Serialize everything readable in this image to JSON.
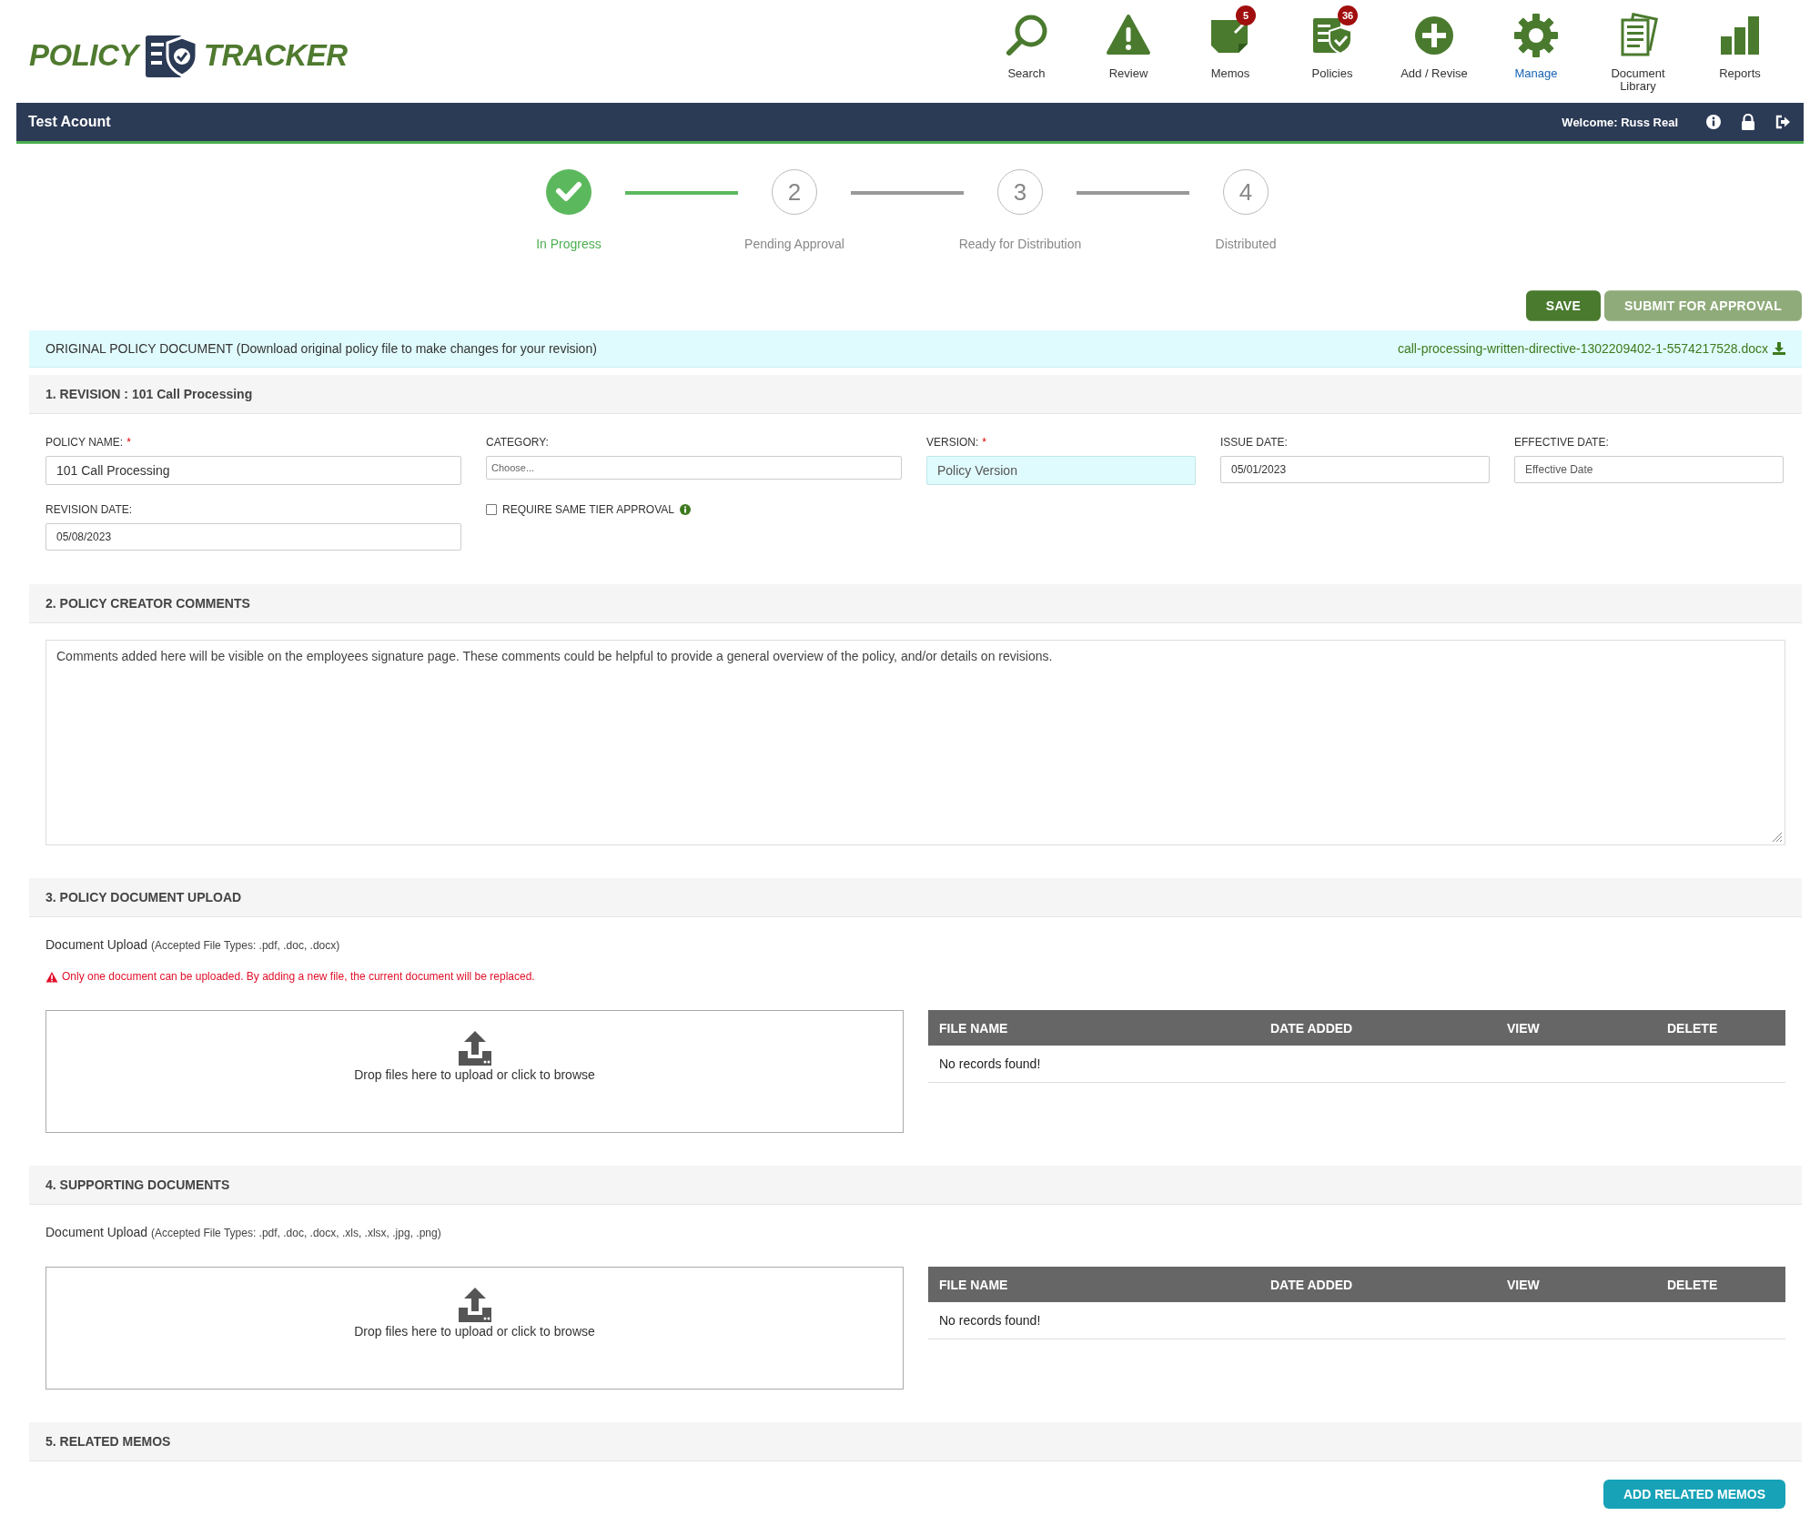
{
  "logo": {
    "left": "POLICY",
    "right": "TRACKER"
  },
  "nav": [
    {
      "label": "Search",
      "kind": "search",
      "selected": false
    },
    {
      "label": "Review",
      "kind": "review",
      "selected": false
    },
    {
      "label": "Memos",
      "kind": "memos",
      "badge": "5",
      "selected": false
    },
    {
      "label": "Policies",
      "kind": "policies",
      "badge": "36",
      "selected": false
    },
    {
      "label": "Add / Revise",
      "kind": "add",
      "selected": false
    },
    {
      "label": "Manage",
      "kind": "manage",
      "selected": true
    },
    {
      "label": "Document Library",
      "kind": "library",
      "selected": false
    },
    {
      "label": "Reports",
      "kind": "reports",
      "selected": false
    }
  ],
  "account_bar": {
    "account": "Test Acount",
    "welcome": "Welcome: Russ Real"
  },
  "steps": [
    {
      "label": "In Progress",
      "done": true
    },
    {
      "number": "2",
      "label": "Pending Approval",
      "done": false
    },
    {
      "number": "3",
      "label": "Ready for Distribution",
      "done": false
    },
    {
      "number": "4",
      "label": "Distributed",
      "done": false
    }
  ],
  "actions": [
    {
      "label": "SAVE",
      "kind": "primary"
    },
    {
      "label": "SUBMIT FOR APPROVAL",
      "kind": "secondary"
    }
  ],
  "original_document": {
    "text": "ORIGINAL POLICY DOCUMENT (Download original policy file to make changes for your revision)",
    "file": "call-processing-written-directive-1302209402-1-5574217528.docx"
  },
  "sections": [
    {
      "kind": "revision",
      "title": "1. REVISION : 101 Call Processing",
      "fields": [
        {
          "kind": "text",
          "label": "POLICY NAME:",
          "required_mark": "*",
          "value": "101 Call Processing",
          "highlighted": false
        },
        {
          "kind": "select",
          "label": "CATEGORY:",
          "placeholder": "Choose...",
          "highlighted": false
        },
        {
          "kind": "text",
          "label": "VERSION:",
          "required_mark": "*",
          "placeholder": "Policy Version",
          "highlighted": true
        },
        {
          "kind": "date",
          "label": "ISSUE DATE:",
          "value": "05/01/2023",
          "highlighted": false
        },
        {
          "kind": "date",
          "label": "EFFECTIVE DATE:",
          "placeholder": "Effective Date",
          "highlighted": false
        },
        {
          "kind": "date",
          "label": "REVISION DATE:",
          "value": "05/08/2023",
          "highlighted": false
        },
        {
          "kind": "checkbox",
          "label": "REQUIRE SAME TIER APPROVAL",
          "checked": false
        }
      ]
    },
    {
      "kind": "comments",
      "title": "2. POLICY CREATOR COMMENTS",
      "value": "Comments added here will be visible on the employees signature page. These comments could be helpful to provide a general overview of the policy, and/or details on revisions."
    },
    {
      "kind": "upload",
      "title": "3. POLICY DOCUMENT UPLOAD",
      "caption": "Document Upload",
      "hint": "(Accepted File Types: .pdf, .doc, .docx)",
      "warning": "Only one document can be uploaded. By adding a new file, the current document will be replaced.",
      "drop_text": "Drop files here to upload or click to browse",
      "columns": [
        "FILE NAME",
        "DATE ADDED",
        "VIEW",
        "DELETE"
      ],
      "empty_text": "No records found!"
    },
    {
      "kind": "upload",
      "title": "4. SUPPORTING DOCUMENTS",
      "caption": "Document Upload",
      "hint": "(Accepted File Types: .pdf, .doc, .docx, .xls, .xlsx, .jpg, .png)",
      "drop_text": "Drop files here to upload or click to browse",
      "columns": [
        "FILE NAME",
        "DATE ADDED",
        "VIEW",
        "DELETE"
      ],
      "empty_text": "No records found!"
    },
    {
      "kind": "memos",
      "title": "5. RELATED MEMOS",
      "button": "ADD RELATED MEMOS"
    }
  ]
}
